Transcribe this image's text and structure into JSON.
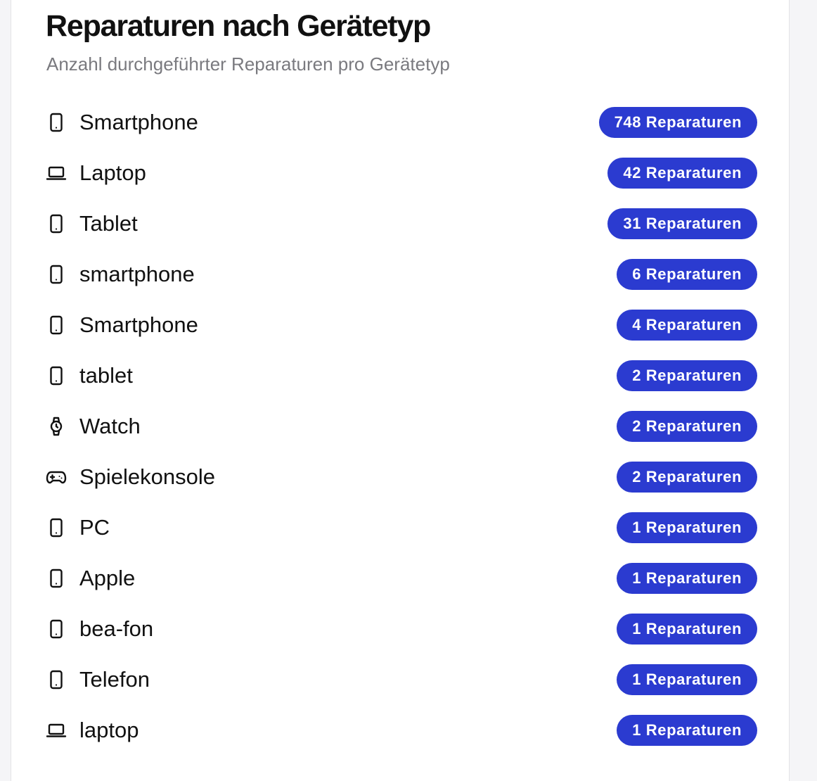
{
  "header": {
    "title": "Reparaturen nach Gerätetyp",
    "subtitle": "Anzahl durchgeführter Reparaturen pro Gerätetyp"
  },
  "colors": {
    "badge": "#2b3bd0",
    "text": "#111111",
    "muted": "#7a7a7f"
  },
  "items": [
    {
      "label": "Smartphone",
      "icon": "phone-icon",
      "count": 748,
      "badge": "748 Reparaturen"
    },
    {
      "label": "Laptop",
      "icon": "laptop-icon",
      "count": 42,
      "badge": "42 Reparaturen"
    },
    {
      "label": "Tablet",
      "icon": "phone-icon",
      "count": 31,
      "badge": "31 Reparaturen"
    },
    {
      "label": "smartphone",
      "icon": "phone-icon",
      "count": 6,
      "badge": "6 Reparaturen"
    },
    {
      "label": "Smartphone",
      "icon": "phone-icon",
      "count": 4,
      "badge": "4 Reparaturen"
    },
    {
      "label": "tablet",
      "icon": "phone-icon",
      "count": 2,
      "badge": "2 Reparaturen"
    },
    {
      "label": "Watch",
      "icon": "watch-icon",
      "count": 2,
      "badge": "2 Reparaturen"
    },
    {
      "label": "Spielekonsole",
      "icon": "gamepad-icon",
      "count": 2,
      "badge": "2 Reparaturen"
    },
    {
      "label": "PC",
      "icon": "phone-icon",
      "count": 1,
      "badge": "1 Reparaturen"
    },
    {
      "label": "Apple",
      "icon": "phone-icon",
      "count": 1,
      "badge": "1 Reparaturen"
    },
    {
      "label": "bea-fon",
      "icon": "phone-icon",
      "count": 1,
      "badge": "1 Reparaturen"
    },
    {
      "label": "Telefon",
      "icon": "phone-icon",
      "count": 1,
      "badge": "1 Reparaturen"
    },
    {
      "label": "laptop",
      "icon": "laptop-icon",
      "count": 1,
      "badge": "1 Reparaturen"
    }
  ]
}
